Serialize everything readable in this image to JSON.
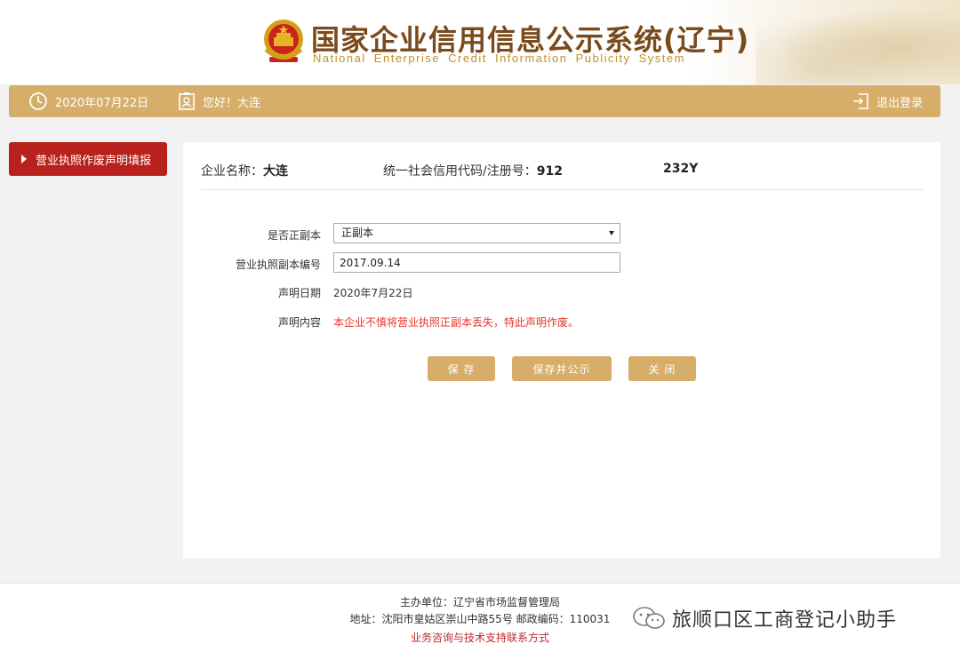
{
  "header": {
    "title_cn": "国家企业信用信息公示系统(辽宁)",
    "title_en": "National Enterprise Credit Information Publicity System"
  },
  "topbar": {
    "date": "2020年07月22日",
    "greeting": "您好！大连",
    "logout": "退出登录"
  },
  "sidebar": {
    "items": [
      {
        "label": "营业执照作废声明填报"
      }
    ]
  },
  "company": {
    "name_label": "企业名称：",
    "name": "大连",
    "code_label": "统一社会信用代码/注册号：",
    "code_part1": "912",
    "code_part2": "232Y"
  },
  "form": {
    "copy_type_label": "是否正副本",
    "copy_type_value": "正副本",
    "license_no_label": "营业执照副本编号",
    "license_no_value": "2017.09.14",
    "decl_date_label": "声明日期",
    "decl_date_value": "2020年7月22日",
    "decl_content_label": "声明内容",
    "decl_content_value": "本企业不慎将营业执照正副本丢失，特此声明作废。"
  },
  "buttons": {
    "save": "保 存",
    "save_publish": "保存并公示",
    "close": "关 闭"
  },
  "footer": {
    "host": "主办单位：辽宁省市场监督管理局",
    "address": "地址：沈阳市皇姑区崇山中路55号 邮政编码：110031",
    "support": "业务咨询与技术支持联系方式"
  },
  "watermark": {
    "text": "旅顺口区工商登记小助手"
  },
  "colors": {
    "gold": "#d6ae6a",
    "red": "#b9221c",
    "alert_red": "#e8332a",
    "title_brown": "#7a4a1a"
  }
}
